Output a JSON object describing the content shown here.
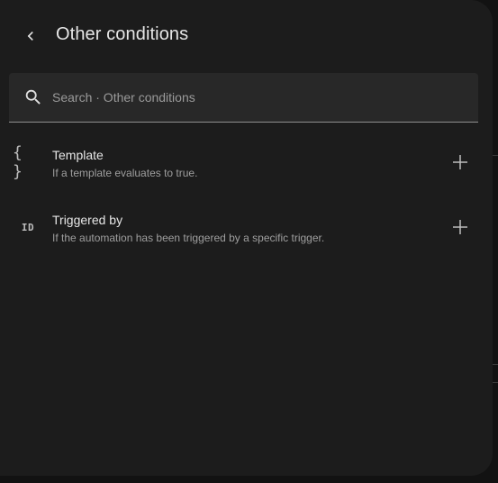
{
  "dialog": {
    "title": "Other conditions",
    "back_icon": "chevron-left-icon"
  },
  "search": {
    "placeholder": "Search · Other conditions",
    "value": "",
    "icon": "search-icon"
  },
  "items": [
    {
      "icon": "code-braces-icon",
      "icon_text": "{ }",
      "title": "Template",
      "description": "If a template evaluates to true.",
      "action_icon": "plus-icon"
    },
    {
      "icon": "identifier-icon",
      "icon_text": "ID",
      "title": "Triggered by",
      "description": "If the automation has been triggered by a specific trigger.",
      "action_icon": "plus-icon"
    }
  ],
  "colors": {
    "dialog_bg": "#1c1c1c",
    "search_bg": "#282828",
    "text_primary": "#e6e6e6",
    "text_secondary": "#9e9e9e"
  }
}
